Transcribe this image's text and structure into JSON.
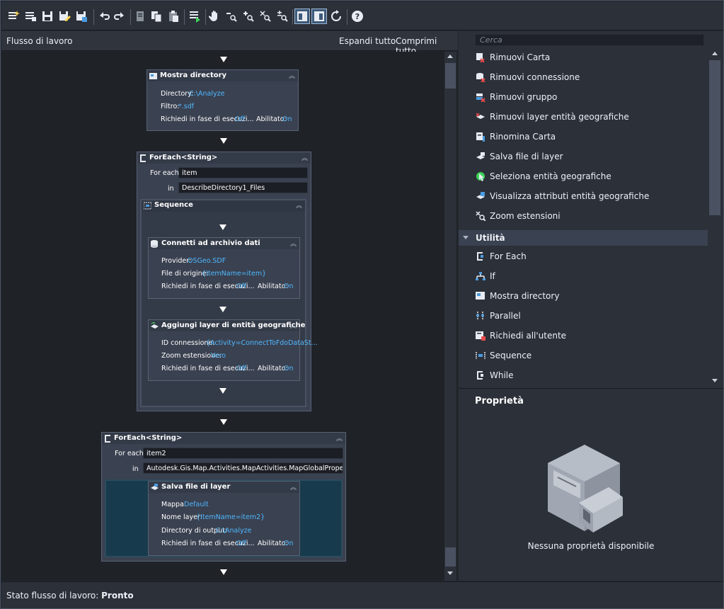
{
  "left_panel": {
    "title": "Flusso di lavoro",
    "expand_all": "Espandi tutto",
    "collapse_all": "Comprimi tutto"
  },
  "workflow": {
    "describe": {
      "title": "Mostra directory",
      "directory_label": "Directory:",
      "directory_value": "C:\\Analyze",
      "filter_label": "Filtro:",
      "filter_value": "*.sdf",
      "prompt_label": "Richiedi in fase di esecuzi...",
      "prompt_value": "Off",
      "enabled_label": "Abilitato:",
      "enabled_value": "On"
    },
    "foreach1": {
      "title": "ForEach<String>",
      "foreach_label": "For each",
      "foreach_value": "item",
      "in_label": "in",
      "in_value": "DescribeDirectory1_Files",
      "sequence_title": "Sequence",
      "connect": {
        "title": "Connetti ad archivio dati",
        "provider_label": "Provider:",
        "provider_value": "OSGeo.SDF",
        "source_label": "File di origine:",
        "source_value": "{ItemName=item}",
        "prompt_label": "Richiedi in fase di esecuzi...",
        "prompt_value": "Off",
        "enabled_label": "Abilitato:",
        "enabled_value": "On"
      },
      "addlayer": {
        "title": "Aggiungi layer di entità geografiche",
        "conn_label": "ID connessione:",
        "conn_value": "{Activity=ConnectToFdoDataSt...",
        "zoom_label": "Zoom estensione:",
        "zoom_value": "Vero",
        "prompt_label": "Richiedi in fase di esecuzi...",
        "prompt_value": "Off",
        "enabled_label": "Abilitato:",
        "enabled_value": "On"
      }
    },
    "foreach2": {
      "title": "ForEach<String>",
      "foreach_label": "For each",
      "foreach_value": "item2",
      "in_label": "in",
      "in_value": "Autodesk.Gis.Map.Activities.MapActivities.MapGlobalProperties.Layers",
      "savelayer": {
        "title": "Salva file di layer",
        "map_label": "Mappa:",
        "map_value": "Default",
        "layer_label": "Nome layer:",
        "layer_value": "{ItemName=item2}",
        "outdir_label": "Directory di output:",
        "outdir_value": "C:\\Analyze",
        "prompt_label": "Richiedi in fase di esecuzi...",
        "prompt_value": "Off",
        "enabled_label": "Abilitato:",
        "enabled_value": "On"
      }
    }
  },
  "toolbox": {
    "search_placeholder": "Cerca",
    "items": [
      {
        "label": "Rimuovi Carta",
        "icon": "remove-map-icon"
      },
      {
        "label": "Rimuovi connessione",
        "icon": "remove-connection-icon"
      },
      {
        "label": "Rimuovi gruppo",
        "icon": "remove-group-icon"
      },
      {
        "label": "Rimuovi layer entità geografiche",
        "icon": "remove-feature-layer-icon"
      },
      {
        "label": "Rinomina Carta",
        "icon": "rename-map-icon"
      },
      {
        "label": "Salva file di layer",
        "icon": "save-layer-file-icon"
      },
      {
        "label": "Seleziona entità geografiche",
        "icon": "select-features-icon"
      },
      {
        "label": "Visualizza attributi entità geografiche",
        "icon": "view-feature-attributes-icon"
      },
      {
        "label": "Zoom estensioni",
        "icon": "zoom-extents-icon"
      }
    ],
    "category": "Utilità",
    "utility_items": [
      {
        "label": "For Each",
        "icon": "foreach-icon"
      },
      {
        "label": "If",
        "icon": "if-icon"
      },
      {
        "label": "Mostra directory",
        "icon": "describe-directory-icon"
      },
      {
        "label": "Parallel",
        "icon": "parallel-icon"
      },
      {
        "label": "Richiedi all'utente",
        "icon": "prompt-user-icon"
      },
      {
        "label": "Sequence",
        "icon": "sequence-icon"
      },
      {
        "label": "While",
        "icon": "while-icon"
      }
    ]
  },
  "properties": {
    "title": "Proprietà",
    "empty_message": "Nessuna proprietà disponibile"
  },
  "status": {
    "label": "Stato flusso di lavoro:",
    "value": "Pronto"
  },
  "colors": {
    "accent_value": "#4fb8ff",
    "selection": "#173b4d"
  }
}
